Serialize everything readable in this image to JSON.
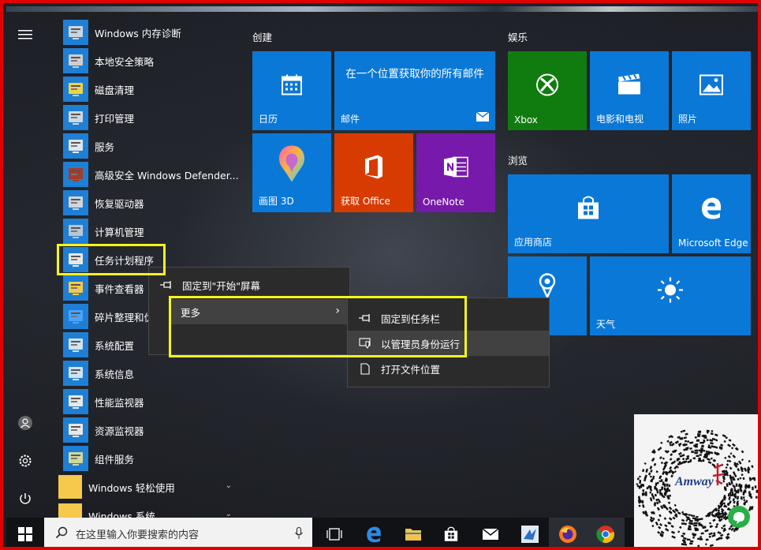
{
  "apps": [
    {
      "label": "Windows 内存诊断",
      "icon": "memory-diagnostic-icon"
    },
    {
      "label": "本地安全策略",
      "icon": "security-policy-icon"
    },
    {
      "label": "磁盘清理",
      "icon": "disk-cleanup-icon"
    },
    {
      "label": "打印管理",
      "icon": "print-management-icon"
    },
    {
      "label": "服务",
      "icon": "services-gear-icon"
    },
    {
      "label": "高级安全 Windows Defender...",
      "icon": "firewall-icon"
    },
    {
      "label": "恢复驱动器",
      "icon": "recovery-drive-icon"
    },
    {
      "label": "计算机管理",
      "icon": "computer-management-icon"
    },
    {
      "label": "任务计划程序",
      "icon": "task-scheduler-clock-icon"
    },
    {
      "label": "事件查看器",
      "icon": "event-viewer-icon"
    },
    {
      "label": "碎片整理和优",
      "icon": "defrag-icon"
    },
    {
      "label": "系统配置",
      "icon": "system-config-icon"
    },
    {
      "label": "系统信息",
      "icon": "system-info-icon"
    },
    {
      "label": "性能监视器",
      "icon": "performance-monitor-icon"
    },
    {
      "label": "资源监视器",
      "icon": "resource-monitor-icon"
    },
    {
      "label": "组件服务",
      "icon": "component-services-icon"
    }
  ],
  "folders": [
    {
      "label": "Windows 轻松使用"
    },
    {
      "label": "Windows 系统"
    }
  ],
  "groups": {
    "create": "创建",
    "entertainment": "娱乐",
    "browse": "浏览"
  },
  "tiles": {
    "calendar": "日历",
    "mail_headline": "在一个位置获取你的所有邮件",
    "mail": "邮件",
    "paint3d": "画图 3D",
    "office": "获取 Office",
    "onenote": "OneNote",
    "xbox": "Xbox",
    "movies": "电影和电视",
    "photos": "照片",
    "store": "应用商店",
    "edge": "Microsoft Edge",
    "weather": "天气"
  },
  "context_menu": {
    "pin_start": "固定到\"开始\"屏幕",
    "more": "更多"
  },
  "submenu": {
    "pin_taskbar": "固定到任务栏",
    "run_admin": "以管理员身份运行",
    "open_location": "打开文件位置"
  },
  "taskbar": {
    "search_placeholder": "在这里输入你要搜索的内容"
  },
  "qr_brand": "Amway",
  "colors": {
    "tile_blue": "#0a78d7",
    "xbox_green": "#107c10",
    "office_orange": "#d83b01",
    "onenote_purple": "#7719aa",
    "highlight_yellow": "#f5f51a"
  }
}
